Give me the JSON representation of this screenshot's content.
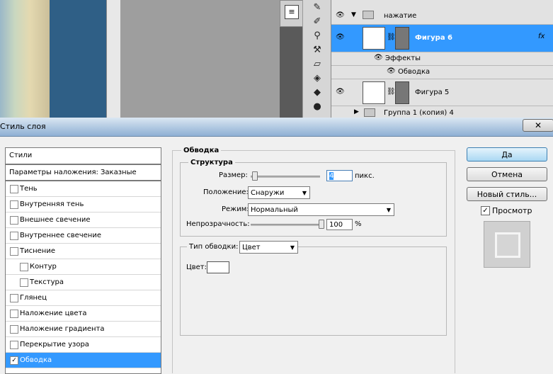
{
  "layers_panel": {
    "layers": [
      {
        "name": "нажатие"
      },
      {
        "name": "Фигура 6",
        "fx": "fx"
      },
      {
        "name": "Эффекты"
      },
      {
        "name": "Обводка"
      },
      {
        "name": "Фигура 5"
      },
      {
        "name": "Группа 1 (копия) 4"
      }
    ]
  },
  "dialog": {
    "title": "Стиль слоя",
    "close_icon": "✕",
    "styles_header": "Стили",
    "blending_options": "Параметры наложения: Заказные",
    "styles": [
      {
        "label": "Тень",
        "checked": false,
        "indent": false
      },
      {
        "label": "Внутренняя тень",
        "checked": false,
        "indent": false
      },
      {
        "label": "Внешнее свечение",
        "checked": false,
        "indent": false
      },
      {
        "label": "Внутреннее свечение",
        "checked": false,
        "indent": false
      },
      {
        "label": "Тиснение",
        "checked": false,
        "indent": false
      },
      {
        "label": "Контур",
        "checked": false,
        "indent": true
      },
      {
        "label": "Текстура",
        "checked": false,
        "indent": true
      },
      {
        "label": "Глянец",
        "checked": false,
        "indent": false
      },
      {
        "label": "Наложение цвета",
        "checked": false,
        "indent": false
      },
      {
        "label": "Наложение градиента",
        "checked": false,
        "indent": false
      },
      {
        "label": "Перекрытие узора",
        "checked": false,
        "indent": false
      },
      {
        "label": "Обводка",
        "checked": true,
        "indent": false,
        "selected": true
      }
    ],
    "stroke": {
      "section_title": "Обводка",
      "structure_title": "Структура",
      "size_label": "Размер:",
      "size_value": "4",
      "size_unit": "пикс.",
      "size_level": 0.02,
      "position_label": "Положение:",
      "position_value": "Снаружи",
      "mode_label": "Режим:",
      "mode_value": "Нормальный",
      "opacity_label": "Непрозрачность:",
      "opacity_value": "100",
      "opacity_unit": "%",
      "opacity_level": 1.0,
      "fill_type_label": "Тип обводки:",
      "fill_type_value": "Цвет",
      "color_label": "Цвет:",
      "color_value": "#ffffff"
    },
    "buttons": {
      "ok": "Да",
      "cancel": "Отмена",
      "new_style": "Новый стиль...",
      "preview_label": "Просмотр",
      "preview_checked": true
    }
  }
}
